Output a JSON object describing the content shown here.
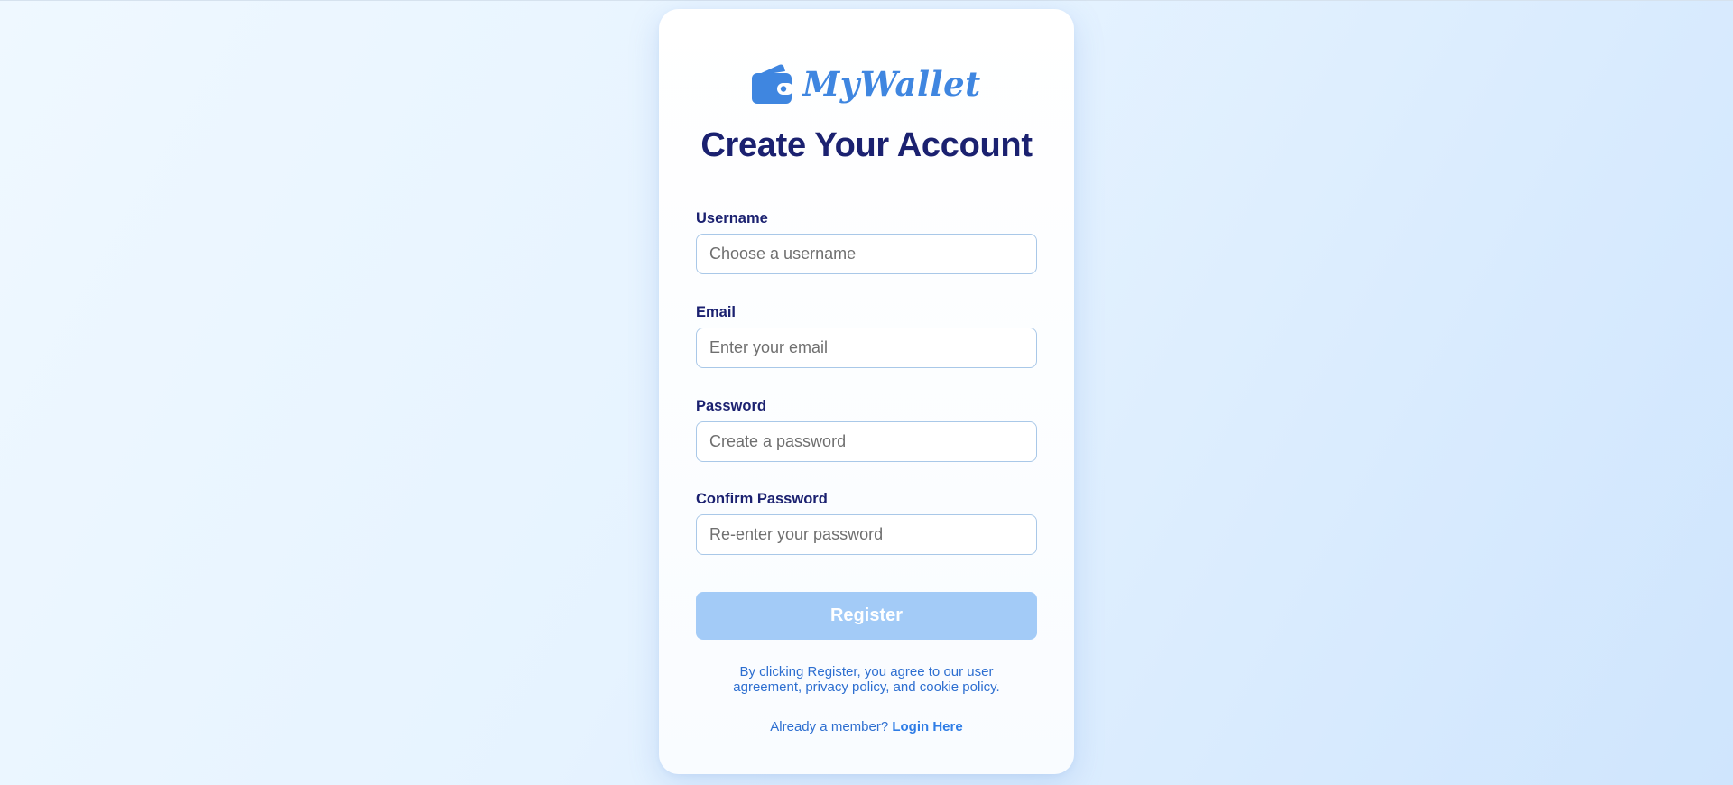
{
  "brand": {
    "name": "MyWallet",
    "icon": "wallet-icon",
    "color": "#3f86e0"
  },
  "page": {
    "title": "Create Your Account"
  },
  "form": {
    "fields": [
      {
        "label": "Username",
        "placeholder": "Choose a username",
        "value": ""
      },
      {
        "label": "Email",
        "placeholder": "Enter your email",
        "value": ""
      },
      {
        "label": "Password",
        "placeholder": "Create a password",
        "value": ""
      },
      {
        "label": "Confirm Password",
        "placeholder": "Re-enter your password",
        "value": ""
      }
    ],
    "submit_label": "Register",
    "submit_color": "#a3cbf7"
  },
  "footer": {
    "agreement": "By clicking Register, you agree to our user agreement, privacy policy, and cookie policy.",
    "login_prompt": "Already a member?",
    "login_link": "Login Here"
  },
  "colors": {
    "title": "#1b2170",
    "link": "#2f7de6",
    "input_border": "#a9c8e8"
  }
}
